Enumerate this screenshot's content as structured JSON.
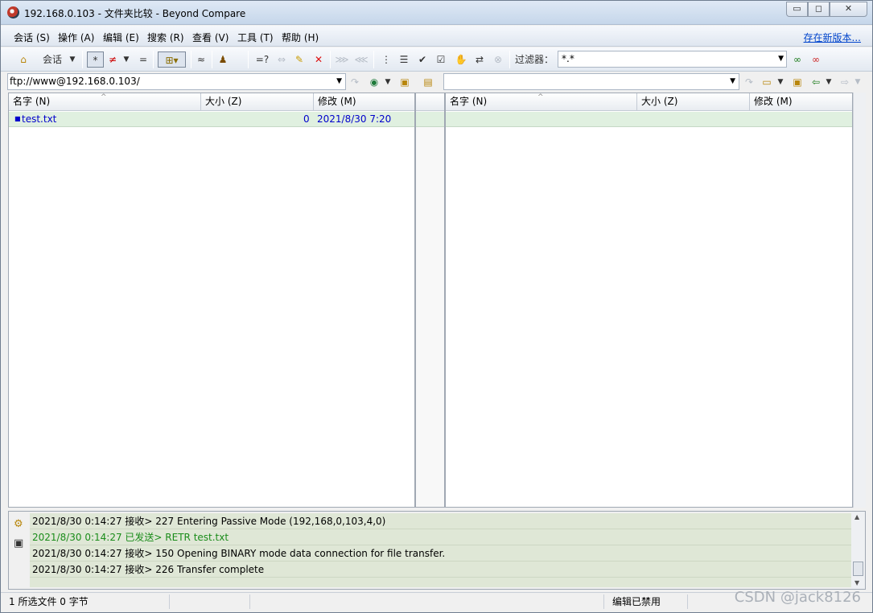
{
  "window": {
    "title": "192.168.0.103 - 文件夹比较 - Beyond Compare",
    "buttons": {
      "minimize": "▭",
      "maximize": "◻",
      "close": "✕"
    }
  },
  "menu": {
    "items": [
      "会话 (S)",
      "操作 (A)",
      "编辑 (E)",
      "搜索 (R)",
      "查看 (V)",
      "工具 (T)",
      "帮助 (H)"
    ],
    "update_link": "存在新版本..."
  },
  "toolbar": {
    "session_label": "会话",
    "all_label": "*",
    "diff_label": "≠",
    "same_label": "=",
    "approx_label": "≈",
    "compare_label": "=?",
    "filter_label": "过滤器：",
    "filter_value": "*.*"
  },
  "paths": {
    "left": "ftp://www@192.168.0.103/",
    "right": ""
  },
  "left_pane": {
    "columns": [
      "名字 (N)",
      "大小 (Z)",
      "修改 (M)"
    ],
    "rows": [
      {
        "name": "test.txt",
        "size": "0",
        "modified": "2021/8/30 7:20"
      }
    ]
  },
  "right_pane": {
    "columns": [
      "名字 (N)",
      "大小 (Z)",
      "修改 (M)"
    ]
  },
  "log": [
    {
      "text": "2021/8/30 0:14:27  接收> 227 Entering Passive Mode (192,168,0,103,4,0)",
      "kind": "recv"
    },
    {
      "text": "2021/8/30 0:14:27  已发送> RETR test.txt",
      "kind": "sent"
    },
    {
      "text": "2021/8/30 0:14:27  接收> 150 Opening BINARY mode data connection for file transfer.",
      "kind": "recv"
    },
    {
      "text": "2021/8/30 0:14:27  接收> 226 Transfer complete",
      "kind": "recv"
    }
  ],
  "status": {
    "selection": "1 所选文件 0 字节",
    "edit_state": "编辑已禁用"
  },
  "watermark": "CSDN @jack8126",
  "colors": {
    "row_bg": "#e0f0e0",
    "file_text": "#0000cc",
    "log_sent": "#1a8c1a",
    "link": "#0044cc"
  },
  "icons": [
    "home-icon",
    "filter-toggle-icon",
    "ftp-globe-icon",
    "folder-up-icon",
    "sync-icon",
    "delete-icon",
    "glasses-icon",
    "save-icon",
    "gear-icon"
  ]
}
